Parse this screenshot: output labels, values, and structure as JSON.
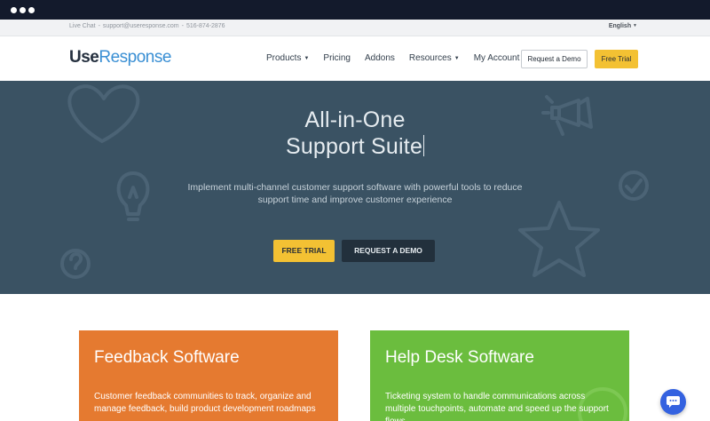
{
  "topbar": {
    "live_chat": "Live Chat",
    "email": "support@useresponse.com",
    "phone": "516-874-2876",
    "language": "English"
  },
  "header": {
    "logo_part1": "Use",
    "logo_part2": "Response",
    "nav": [
      {
        "label": "Products",
        "has_dropdown": true
      },
      {
        "label": "Pricing",
        "has_dropdown": false
      },
      {
        "label": "Addons",
        "has_dropdown": false
      },
      {
        "label": "Resources",
        "has_dropdown": true
      },
      {
        "label": "My Account",
        "has_dropdown": false
      }
    ],
    "request_demo_label": "Request a Demo",
    "free_trial_label": "Free Trial"
  },
  "hero": {
    "title_line1": "All-in-One",
    "title_line2": "Support Suite",
    "subtitle_line1": "Implement multi-channel customer support software with powerful tools to reduce",
    "subtitle_line2": "support time and improve customer experience",
    "free_trial_label": "FREE TRIAL",
    "request_demo_label": "REQUEST A DEMO"
  },
  "cards": [
    {
      "title": "Feedback Software",
      "description": "Customer feedback communities to track, organize and manage feedback, build product development roadmaps"
    },
    {
      "title": "Help Desk Software",
      "description": "Ticketing system to handle communications across multiple touchpoints, automate and speed up the support flows"
    }
  ],
  "colors": {
    "window_bar": "#131a2c",
    "hero_bg": "#3a5263",
    "accent_yellow": "#f3c133",
    "brand_blue": "#3a8fd4",
    "card_orange": "#e57a30",
    "card_green": "#6bbd3e",
    "chat_blue": "#3462e0"
  },
  "icons": [
    "heart-icon",
    "lightbulb-icon",
    "question-icon",
    "megaphone-icon",
    "check-circle-icon",
    "star-icon",
    "chat-icon",
    "chevron-down-icon"
  ]
}
